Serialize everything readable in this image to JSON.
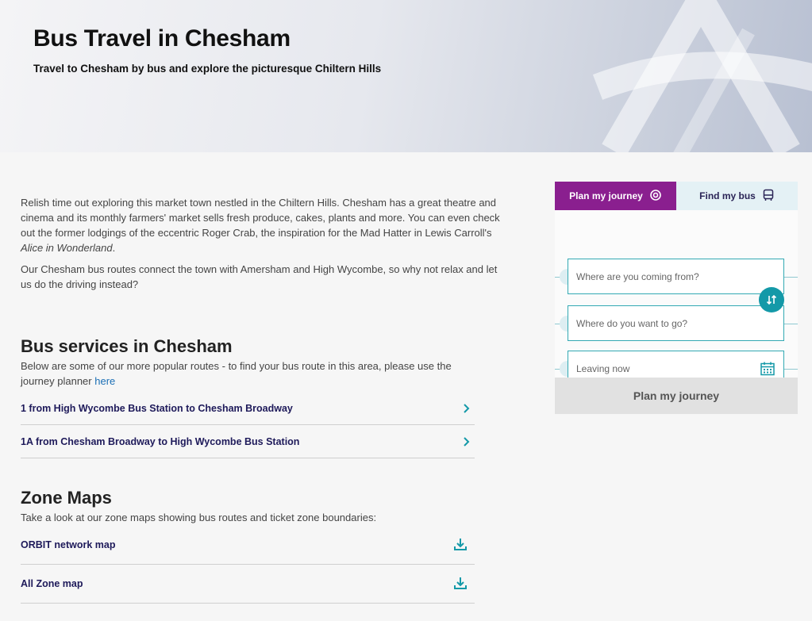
{
  "hero": {
    "title": "Bus Travel in Chesham",
    "subtitle": "Travel to Chesham by bus and explore the picturesque Chiltern Hills"
  },
  "intro": {
    "p1_start": "Relish time out exploring this market town nestled in the Chiltern Hills. Chesham has a great theatre and cinema and its monthly farmers' market sells fresh produce, cakes, plants and more. You can even check out the former lodgings of the eccentric Roger Crab, the inspiration for the Mad Hatter in Lewis Carroll's ",
    "p1_italic": "Alice in Wonderland",
    "p1_end": ".",
    "p2": "Our Chesham bus routes connect the town with Amersham and High Wycombe, so why not relax and let us do the driving instead?"
  },
  "services": {
    "heading": "Bus services in Chesham",
    "desc": "Below are some of our more popular routes - to find your bus route in this area, please use the journey planner ",
    "desc_link": "here",
    "routes": [
      {
        "label": "1 from High Wycombe Bus Station to Chesham Broadway",
        "icon": "chevron-right-icon"
      },
      {
        "label": "1A from Chesham Broadway to High Wycombe Bus Station",
        "icon": "chevron-right-icon"
      }
    ]
  },
  "zone_maps": {
    "heading": "Zone Maps",
    "desc": "Take a look at our zone maps showing bus routes and ticket zone boundaries:",
    "maps": [
      {
        "label": "ORBIT network map",
        "icon": "download-icon"
      },
      {
        "label": "All Zone map",
        "icon": "download-icon"
      }
    ]
  },
  "widget": {
    "tabs": [
      {
        "label": "Plan my journey",
        "icon": "location-pin-icon",
        "active": true
      },
      {
        "label": "Find my bus",
        "icon": "bus-icon",
        "active": false
      }
    ],
    "from_placeholder": "Where are you coming from?",
    "to_placeholder": "Where do you want to go?",
    "when_value": "Leaving now",
    "submit_label": "Plan my journey"
  },
  "colors": {
    "accent_purple": "#8a1f8f",
    "accent_teal": "#1499a8",
    "link_navy": "#1e1a5a"
  }
}
